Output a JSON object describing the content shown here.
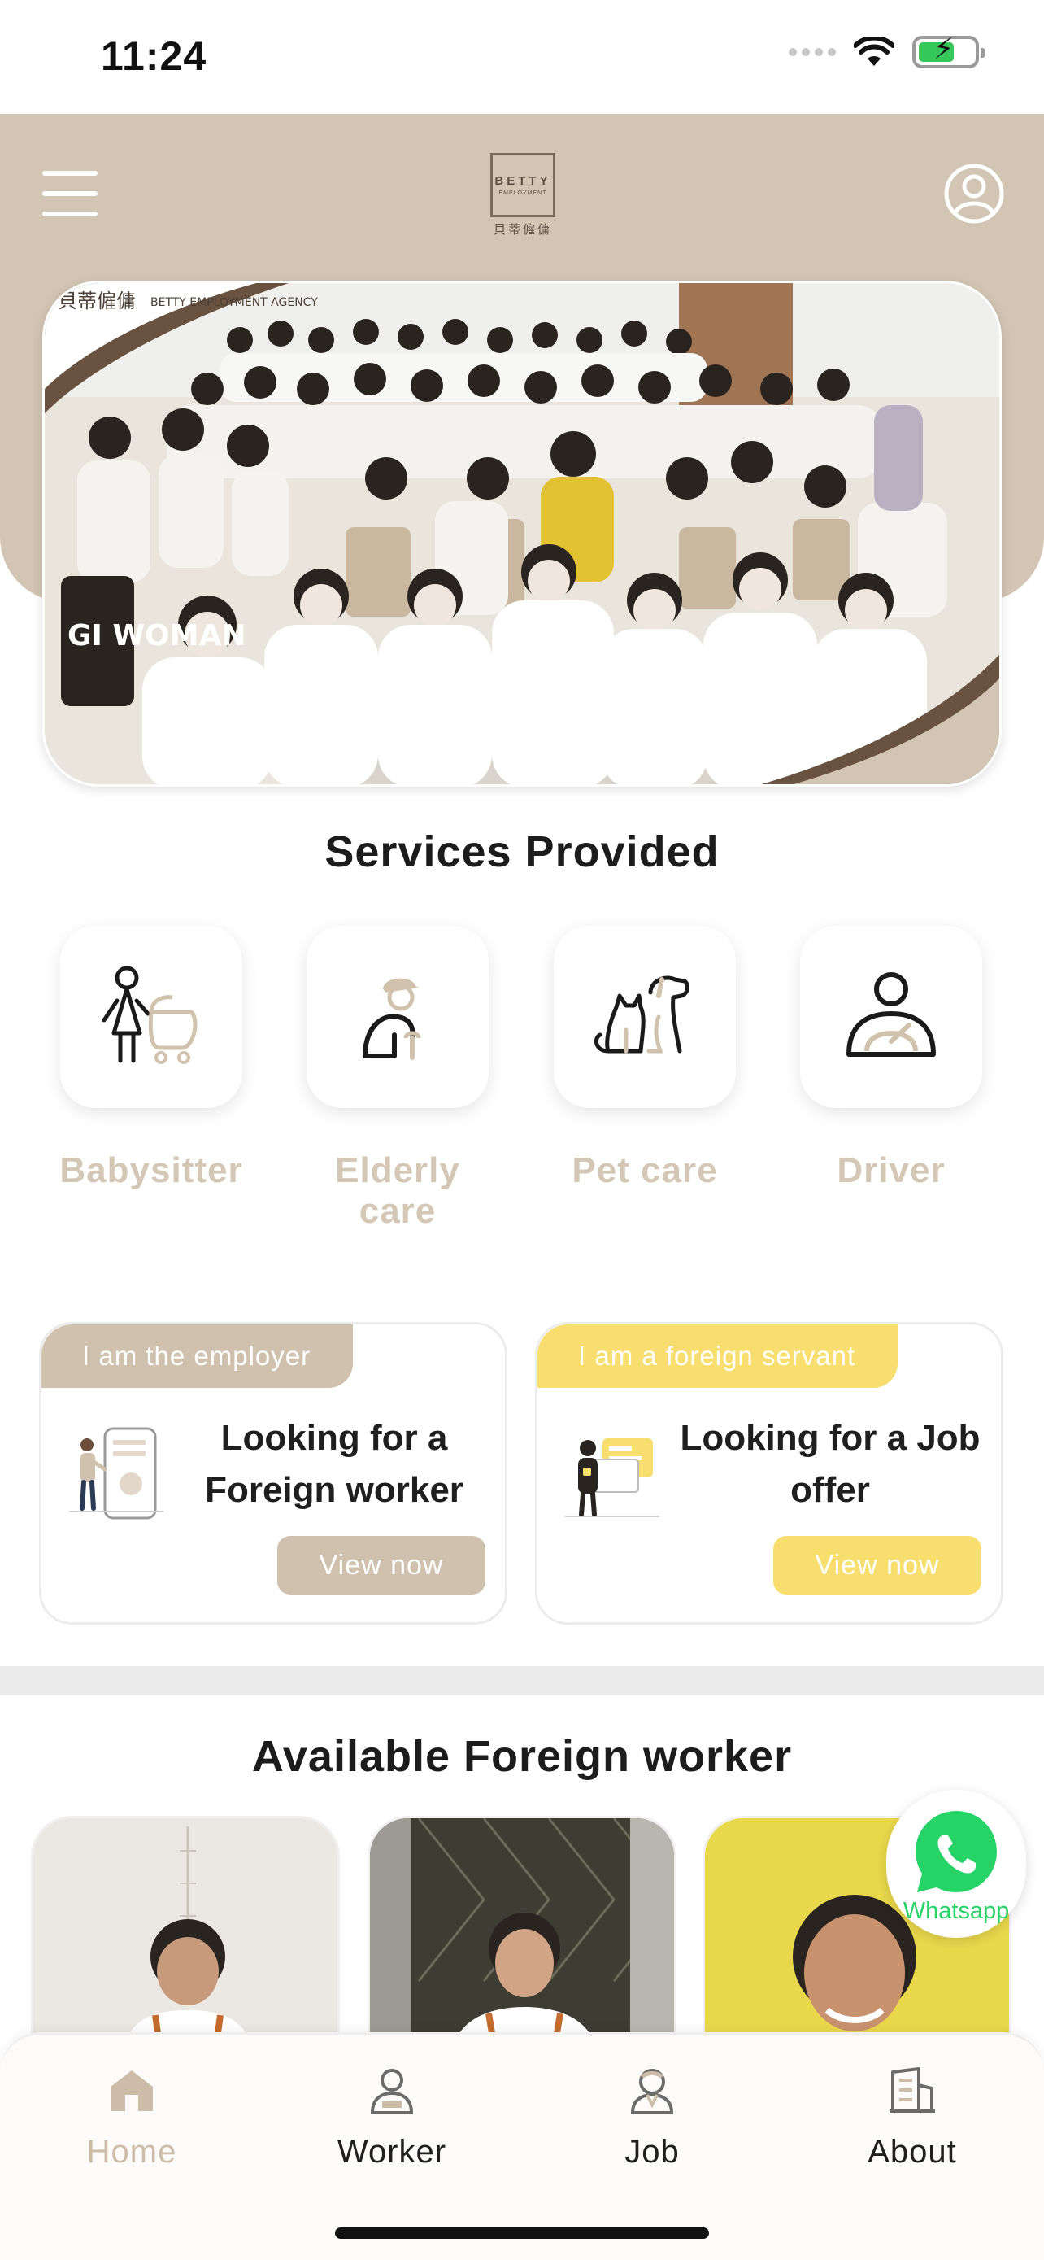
{
  "status_bar": {
    "time": "11:24"
  },
  "header": {
    "menu_icon": "hamburger-menu-icon",
    "logo": {
      "name": "BETTY",
      "sub": "EMPLOYMENT",
      "chinese": "貝蒂僱傭"
    },
    "profile_icon": "user-circle-icon"
  },
  "hero": {
    "brand_cn": "貝蒂僱傭",
    "brand_en": "BETTY EMPLOYMENT AGENCY",
    "shirt_text": "GI WOMAN"
  },
  "services": {
    "title": "Services Provided",
    "items": [
      {
        "label": "Babysitter",
        "icon": "babysitter-stroller-icon"
      },
      {
        "label": "Elderly care",
        "icon": "elderly-cane-icon"
      },
      {
        "label": "Pet care",
        "icon": "pet-cat-dog-icon"
      },
      {
        "label": "Driver",
        "icon": "driver-steering-icon"
      }
    ]
  },
  "roles": [
    {
      "tag": "I am the employer",
      "title_line1": "Looking for a",
      "title_line2": "Foreign worker",
      "button": "View now",
      "color": "#cfc1ae"
    },
    {
      "tag": "I am a foreign servant",
      "title_line1": "Looking for a Job",
      "title_line2": "offer",
      "button": "View now",
      "color": "#f7de6e"
    }
  ],
  "workers": {
    "title": "Available Foreign worker"
  },
  "whatsapp": {
    "label": "Whatsapp",
    "color": "#25d366"
  },
  "bottom_nav": [
    {
      "label": "Home",
      "icon": "home-icon",
      "active": true
    },
    {
      "label": "Worker",
      "icon": "worker-icon",
      "active": false
    },
    {
      "label": "Job",
      "icon": "job-icon",
      "active": false
    },
    {
      "label": "About",
      "icon": "about-building-icon",
      "active": false
    }
  ],
  "colors": {
    "accent": "#d3c5b3",
    "accent_text": "#d4c7b6",
    "employer_button": "#cfc1ae",
    "servant_button": "#f7de6e"
  }
}
